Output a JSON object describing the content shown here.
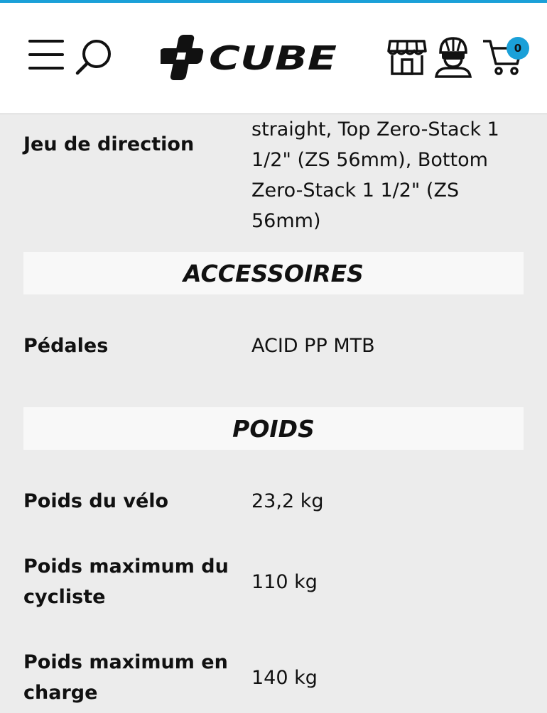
{
  "header": {
    "menu_icon": "hamburger-menu-icon",
    "search_icon": "search-icon",
    "logo_text": "CUBE",
    "store_icon": "store-icon",
    "account_icon": "cyclist-helmet-icon",
    "cart_icon": "shopping-cart-icon",
    "cart_count": "0",
    "accent_color": "#1aa0d8"
  },
  "specs": {
    "headset": {
      "label": "Jeu de direction",
      "value": "straight, Top Zero-Stack 1 1/2\" (ZS 56mm), Bottom Zero-Stack 1 1/2\" (ZS 56mm)"
    },
    "accessories_title": "ACCESSOIRES",
    "pedals": {
      "label": "Pédales",
      "value": "ACID PP MTB"
    },
    "weight_title": "POIDS",
    "bike_weight": {
      "label": "Poids du vélo",
      "value": "23,2 kg"
    },
    "max_rider_weight": {
      "label": "Poids maximum du cycliste",
      "value": "110 kg"
    },
    "max_total_weight": {
      "label": "Poids maximum en charge",
      "value": "140 kg"
    }
  }
}
